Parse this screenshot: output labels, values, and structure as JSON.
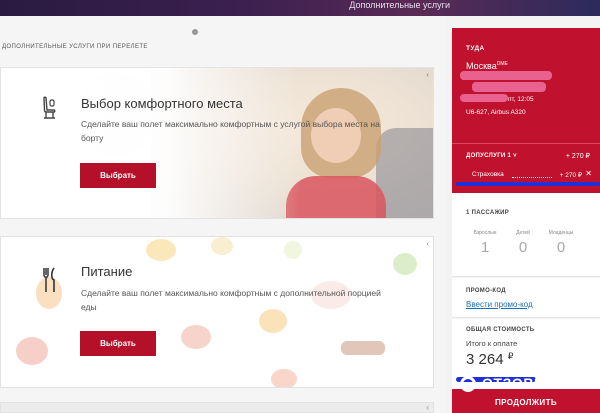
{
  "header": {
    "right_text": "Дополнительные услуги"
  },
  "main": {
    "section_title": "ДОПОЛНИТЕЛЬНЫЕ УСЛУГИ ПРИ ПЕРЕЛЕТЕ",
    "cards": [
      {
        "title": "Выбор комфортного места",
        "description": "Сделайте ваш полет максимально комфортным с услугой выбора места на борту",
        "button": "Выбрать",
        "icon": "seat-icon"
      },
      {
        "title": "Питание",
        "description": "Сделайте ваш полет максимально комфортным с дополнительной порцией еды",
        "button": "Выбрать",
        "icon": "fork-knife-icon"
      }
    ]
  },
  "sidebar": {
    "trip": {
      "label": "ТУДА",
      "city": "Москва",
      "city_sup": "DME",
      "datetime": "пт, 12:05",
      "flight": "U6-627, Airbus A320"
    },
    "extras": {
      "label": "ДОПУСЛУГИ 1",
      "amount": "+ 270 ₽",
      "insurance_label": "Страховка",
      "insurance_amount": "+ 270 ₽",
      "remove_symbol": "✕"
    },
    "passengers": {
      "label": "1 ПАССАЖИР",
      "types": [
        {
          "title": "Взрослые",
          "count": "1"
        },
        {
          "title": "Детей",
          "count": "0"
        },
        {
          "title": "Младенцы",
          "count": "0"
        }
      ]
    },
    "promo": {
      "label": "ПРОМО-КОД",
      "link": "Ввести промо-код"
    },
    "total": {
      "label": "ОБЩАЯ СТОИМОСТЬ",
      "sub": "Итого к оплате",
      "sum": "3 264",
      "currency": "₽"
    },
    "continue": "ПРОДОЛЖИТЬ"
  },
  "watermark": {
    "text": "ОТЗОВИК",
    "sup": "®"
  },
  "colors": {
    "accent": "#c0122e",
    "button": "#b5102a",
    "link": "#1a6fb8"
  }
}
